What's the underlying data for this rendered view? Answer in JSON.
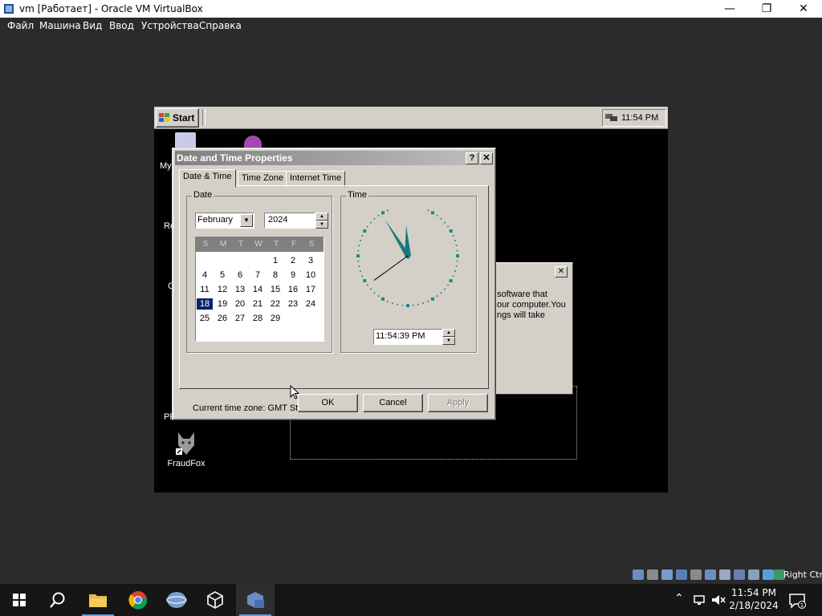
{
  "host": {
    "title": "vm [Работает] - Oracle VM VirtualBox",
    "menu": [
      "Файл",
      "Машина",
      "Вид",
      "Ввод",
      "Устройства",
      "Справка"
    ],
    "status_right_ctrl": "Right Ctrl"
  },
  "guest": {
    "start_label": "Start",
    "tray_time": "11:54 PM",
    "desktop_fragments": [
      "My",
      "Re",
      "C",
      "PF"
    ],
    "fraudfox_label": "FraudFox",
    "bg_dialog_text": [
      "software that",
      "our computer.You",
      "ngs will take"
    ]
  },
  "dialog": {
    "title": "Date and Time Properties",
    "tabs": [
      "Date & Time",
      "Time Zone",
      "Internet Time"
    ],
    "date_group": "Date",
    "time_group": "Time",
    "month": "February",
    "year": "2024",
    "dow": [
      "S",
      "M",
      "T",
      "W",
      "T",
      "F",
      "S"
    ],
    "days": [
      "1",
      "2",
      "3",
      "4",
      "5",
      "6",
      "7",
      "8",
      "9",
      "10",
      "11",
      "12",
      "13",
      "14",
      "15",
      "16",
      "17",
      "18",
      "19",
      "20",
      "21",
      "22",
      "23",
      "24",
      "25",
      "26",
      "27",
      "28",
      "29"
    ],
    "selected_day": "18",
    "time_value": "11:54:39 PM",
    "timezone_text": "Current time zone:  GMT Standard Time",
    "ok": "OK",
    "cancel": "Cancel",
    "apply": "Apply"
  },
  "win_taskbar": {
    "time": "11:54 PM",
    "date": "2/18/2024",
    "notification_count": "1"
  }
}
